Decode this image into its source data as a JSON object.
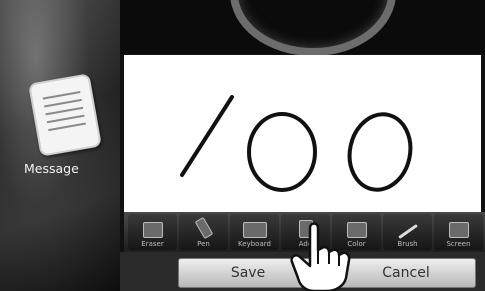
{
  "sidebar": {
    "message_label": "Message"
  },
  "canvas": {
    "handwriting": "100"
  },
  "toolbar": {
    "tools": [
      "Eraser",
      "Pen",
      "Keyboard",
      "Add",
      "Color",
      "Brush",
      "Screen"
    ]
  },
  "actions": {
    "save_label": "Save",
    "cancel_label": "Cancel"
  }
}
